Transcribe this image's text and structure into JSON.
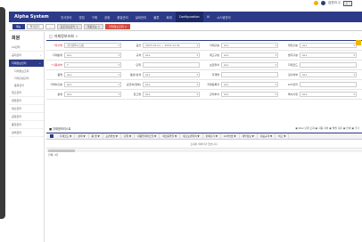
{
  "top": {
    "bulb_icon": "bulb-icon",
    "user_icon": "user-icon",
    "user_text": "김관리 ⓧ",
    "logout": "로그"
  },
  "header": {
    "logo": "Alpha System",
    "menu": [
      "전사관리",
      "영업",
      "구매",
      "공정",
      "품질관리",
      "설비관리",
      "물류",
      "회계",
      "Configuration",
      "AI",
      "시스템관리"
    ],
    "active_index": 8
  },
  "tabs": [
    {
      "label": "메뉴",
      "active": true,
      "doc": false
    },
    {
      "label": "즐겨찾기",
      "active": false,
      "doc": false
    },
    {
      "label": "…",
      "active": false,
      "doc": false
    },
    {
      "label": "표준정보관리 ×",
      "active": false,
      "doc": true
    },
    {
      "label": "제품정보 ×",
      "active": false,
      "doc": true
    },
    {
      "label": "자재정보조회 ×",
      "active": true,
      "doc": true
    }
  ],
  "sidebar": {
    "title": "회원",
    "items": [
      {
        "label": "CS관리",
        "arrow": "›",
        "active": false
      },
      {
        "label": "공지관리",
        "arrow": "›",
        "active": false
      },
      {
        "label": "자재정보관리",
        "arrow": "⌄",
        "active": true
      }
    ],
    "subitems": [
      "자재정보조회",
      "자재구분관리",
      "품목관리"
    ],
    "items2": [
      "재고관리",
      "영업관리",
      "생산관리",
      "공정관리",
      "품질관리",
      "설비관리"
    ]
  },
  "page": {
    "title": "자재정보조회 ☆"
  },
  "filters": [
    [
      {
        "label": "*회사명",
        "req": true,
        "value": "(주)알파시스템",
        "caret": "▾"
      },
      {
        "label": "공급",
        "req": false,
        "value": "2023.01.01 ~ 2023.12.31",
        "caret": "▾"
      },
      {
        "label": "자재구분",
        "req": false,
        "value": "ALL",
        "caret": "▾"
      },
      {
        "label": "재질구분",
        "req": false,
        "value": "ALL",
        "caret": "▾"
      }
    ],
    [
      {
        "label": "자재분류",
        "req": false,
        "value": "ALL",
        "caret": "▾"
      },
      {
        "label": "규격",
        "req": false,
        "value": "ALL",
        "caret": "▾"
      },
      {
        "label": "재고구분",
        "req": false,
        "value": "ALL",
        "caret": "▾"
      },
      {
        "label": "발주구분",
        "req": false,
        "value": "ALL",
        "caret": "▾"
      }
    ],
    [
      {
        "label": "*사용여부",
        "req": true,
        "value": "Y",
        "caret": "▾"
      },
      {
        "label": "단위",
        "req": false,
        "value": "",
        "caret": ""
      },
      {
        "label": "보관위치",
        "req": false,
        "value": "ALL",
        "caret": "▾"
      },
      {
        "label": "자재코드",
        "req": false,
        "value": "",
        "caret": ""
      }
    ],
    [
      {
        "label": "품명",
        "req": false,
        "value": "ALL",
        "caret": "▾"
      },
      {
        "label": "품번/상세",
        "req": false,
        "value": "ALL",
        "caret": "▾"
      },
      {
        "label": "자재명",
        "req": false,
        "value": "",
        "caret": ""
      },
      {
        "label": "검사여부",
        "req": false,
        "value": "ALL",
        "caret": "▾"
      }
    ],
    [
      {
        "label": "거래처구분",
        "req": false,
        "value": "ALL",
        "caret": "▾"
      },
      {
        "label": "공급처(업체)",
        "req": false,
        "value": "ALL",
        "caret": "▾"
      },
      {
        "label": "자재등록자",
        "req": false,
        "value": "ALL",
        "caret": "▾"
      },
      {
        "label": "LOT관리",
        "req": false,
        "value": "",
        "caret": ""
      }
    ],
    [
      {
        "label": "분류",
        "req": false,
        "value": "ALL",
        "caret": "▾"
      },
      {
        "label": "창고명",
        "req": false,
        "value": "ALL",
        "caret": "▾"
      },
      {
        "label": "관리부서",
        "req": false,
        "value": "ALL",
        "caret": "▾"
      },
      {
        "label": "특이사항",
        "req": false,
        "value": "ALL",
        "caret": "▾"
      }
    ]
  ],
  "grid": {
    "title": "■ 자재정보리스트",
    "tools": "▣ Row 단위 조회  ▣ 자동 너비  ▣ 엑셀 다운  ▣ 인쇄  ▣ 추가",
    "columns": [
      "자재코드 ▼",
      "상태 ▼",
      "품 명 ▼",
      "도면번호 ▼",
      "단위 ▼",
      "최종업데이트일 ▼",
      "최초등록일 ▼",
      "재고보관위치 ▼",
      "판매단가 ▼",
      "LOT번호 ▼",
      "세부정보 ▼",
      "대표규격 ▼",
      "비고 ▼"
    ],
    "empty": "조회된 데이터가 없습니다.",
    "count": "전체: 0건"
  },
  "colors": {
    "header": "#2d3a87",
    "accent": "#d24b3d",
    "search": "#f0b400"
  }
}
